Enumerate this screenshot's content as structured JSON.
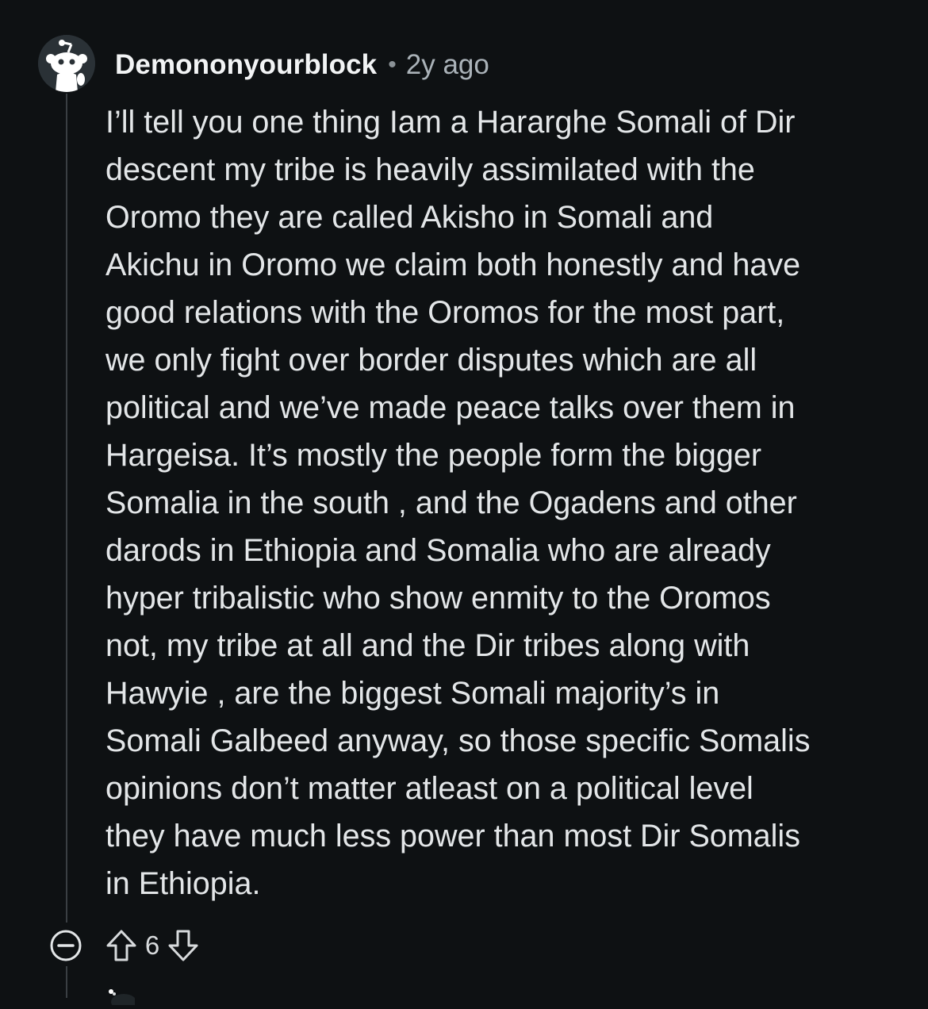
{
  "comment": {
    "username": "Demononyourblock",
    "separator": "•",
    "age": "2y ago",
    "body_lines": [
      "I’ll tell you one thing Iam a Hararghe Somali of Dir",
      "descent my tribe is heavily assimilated with the",
      "Oromo they are called Akisho in Somali and",
      "Akichu in Oromo we claim both honestly and have",
      "good relations with the Oromos for the most part,",
      "we only fight over border disputes which are all",
      "political and we’ve made peace talks over them in",
      "Hargeisa. It’s mostly the people form the bigger",
      "Somalia in the south , and the Ogadens and other",
      "darods in Ethiopia and Somalia who are already",
      "hyper tribalistic who show enmity to the Oromos",
      "not, my tribe at all and the Dir tribes along with",
      "Hawyie , are the biggest Somali majority’s in",
      "Somali Galbeed anyway, so those specific Somalis",
      "opinions don’t matter atleast on a political level",
      "they have much less power than most Dir Somalis",
      "in Ethiopia."
    ],
    "score": "6"
  },
  "icons": {
    "avatar": "snoo-avatar-icon",
    "collapse": "collapse-minus-icon",
    "upvote": "upvote-arrow-icon",
    "downvote": "downvote-arrow-icon"
  },
  "colors": {
    "background": "#0e1113",
    "text": "#e3e6e8",
    "meta": "#aab2b8",
    "thread_line": "#3a3f43"
  }
}
